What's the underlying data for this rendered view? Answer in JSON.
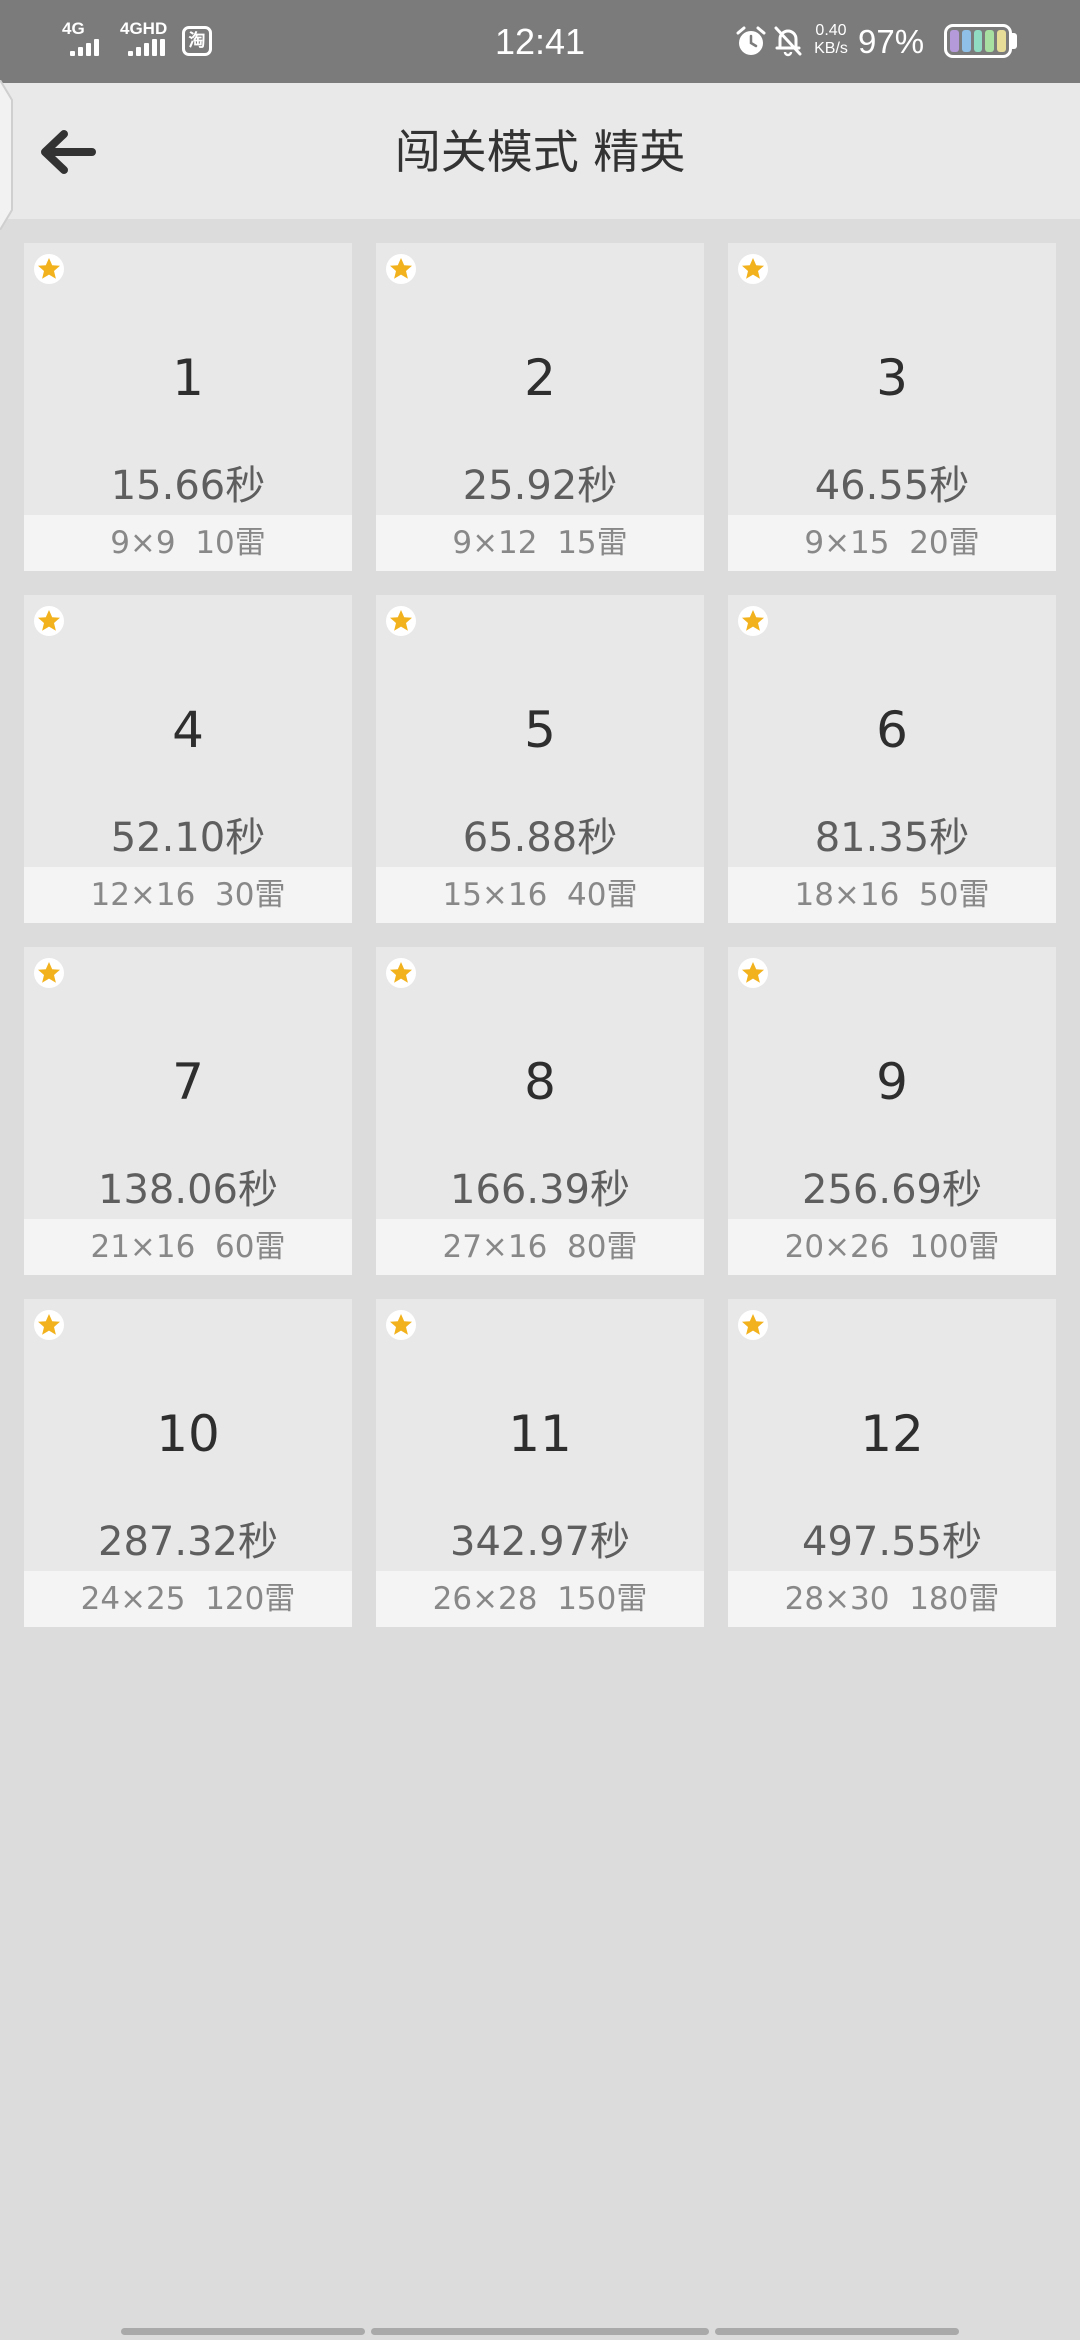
{
  "status_bar": {
    "network_1": "4G",
    "network_2": "4GHD",
    "app_icon_text": "淘",
    "time": "12:41",
    "speed_value": "0.40",
    "speed_unit": "KB/s",
    "battery_percent": "97%",
    "battery_colors": [
      "#b49ad9",
      "#8fc0e8",
      "#8fdcc2",
      "#a7e0a0",
      "#e8dd98"
    ]
  },
  "header": {
    "title": "闯关模式 精英",
    "back_icon": "arrow-left-icon"
  },
  "accent_color": "#f2b21e",
  "levels": [
    {
      "number": "1",
      "time": "15.66秒",
      "info": "9×9  10雷"
    },
    {
      "number": "2",
      "time": "25.92秒",
      "info": "9×12  15雷"
    },
    {
      "number": "3",
      "time": "46.55秒",
      "info": "9×15  20雷"
    },
    {
      "number": "4",
      "time": "52.10秒",
      "info": "12×16  30雷"
    },
    {
      "number": "5",
      "time": "65.88秒",
      "info": "15×16  40雷"
    },
    {
      "number": "6",
      "time": "81.35秒",
      "info": "18×16  50雷"
    },
    {
      "number": "7",
      "time": "138.06秒",
      "info": "21×16  60雷"
    },
    {
      "number": "8",
      "time": "166.39秒",
      "info": "27×16  80雷"
    },
    {
      "number": "9",
      "time": "256.69秒",
      "info": "20×26  100雷"
    },
    {
      "number": "10",
      "time": "287.32秒",
      "info": "24×25  120雷"
    },
    {
      "number": "11",
      "time": "342.97秒",
      "info": "26×28  150雷"
    },
    {
      "number": "12",
      "time": "497.55秒",
      "info": "28×30  180雷"
    }
  ]
}
